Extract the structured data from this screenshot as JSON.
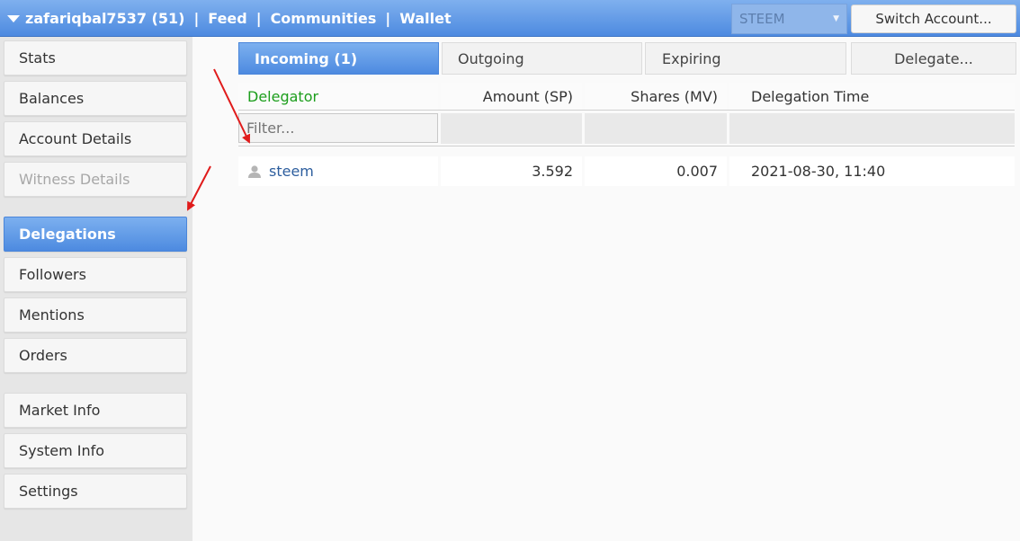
{
  "topbar": {
    "username": "zafariqbal7537",
    "reputation": "(51)",
    "links": [
      "Feed",
      "Communities",
      "Wallet"
    ],
    "chain_selector": "STEEM",
    "switch_account_label": "Switch Account..."
  },
  "sidebar": {
    "items": [
      {
        "label": "Stats"
      },
      {
        "label": "Balances"
      },
      {
        "label": "Account Details"
      },
      {
        "label": "Witness Details"
      },
      {
        "label": "Delegations"
      },
      {
        "label": "Followers"
      },
      {
        "label": "Mentions"
      },
      {
        "label": "Orders"
      },
      {
        "label": "Market Info"
      },
      {
        "label": "System Info"
      },
      {
        "label": "Settings"
      }
    ],
    "active": "Delegations",
    "disabled": "Witness Details"
  },
  "tabs": {
    "items": [
      {
        "label": "Incoming (1)"
      },
      {
        "label": "Outgoing"
      },
      {
        "label": "Expiring"
      },
      {
        "label": "Delegate..."
      }
    ],
    "active": "Incoming (1)"
  },
  "table": {
    "columns": [
      "Delegator",
      "Amount (SP)",
      "Shares (MV)",
      "Delegation Time"
    ],
    "filter_placeholder": "Filter...",
    "rows": [
      {
        "delegator": "steem",
        "amount_sp": "3.592",
        "shares_mv": "0.007",
        "time": "2021-08-30, 11:40"
      }
    ]
  },
  "colors": {
    "accent_blue": "#4d8ae0",
    "delegator_header": "#1c9e1c",
    "link": "#2d5e9e",
    "annotation_arrow": "#e01b1b"
  }
}
